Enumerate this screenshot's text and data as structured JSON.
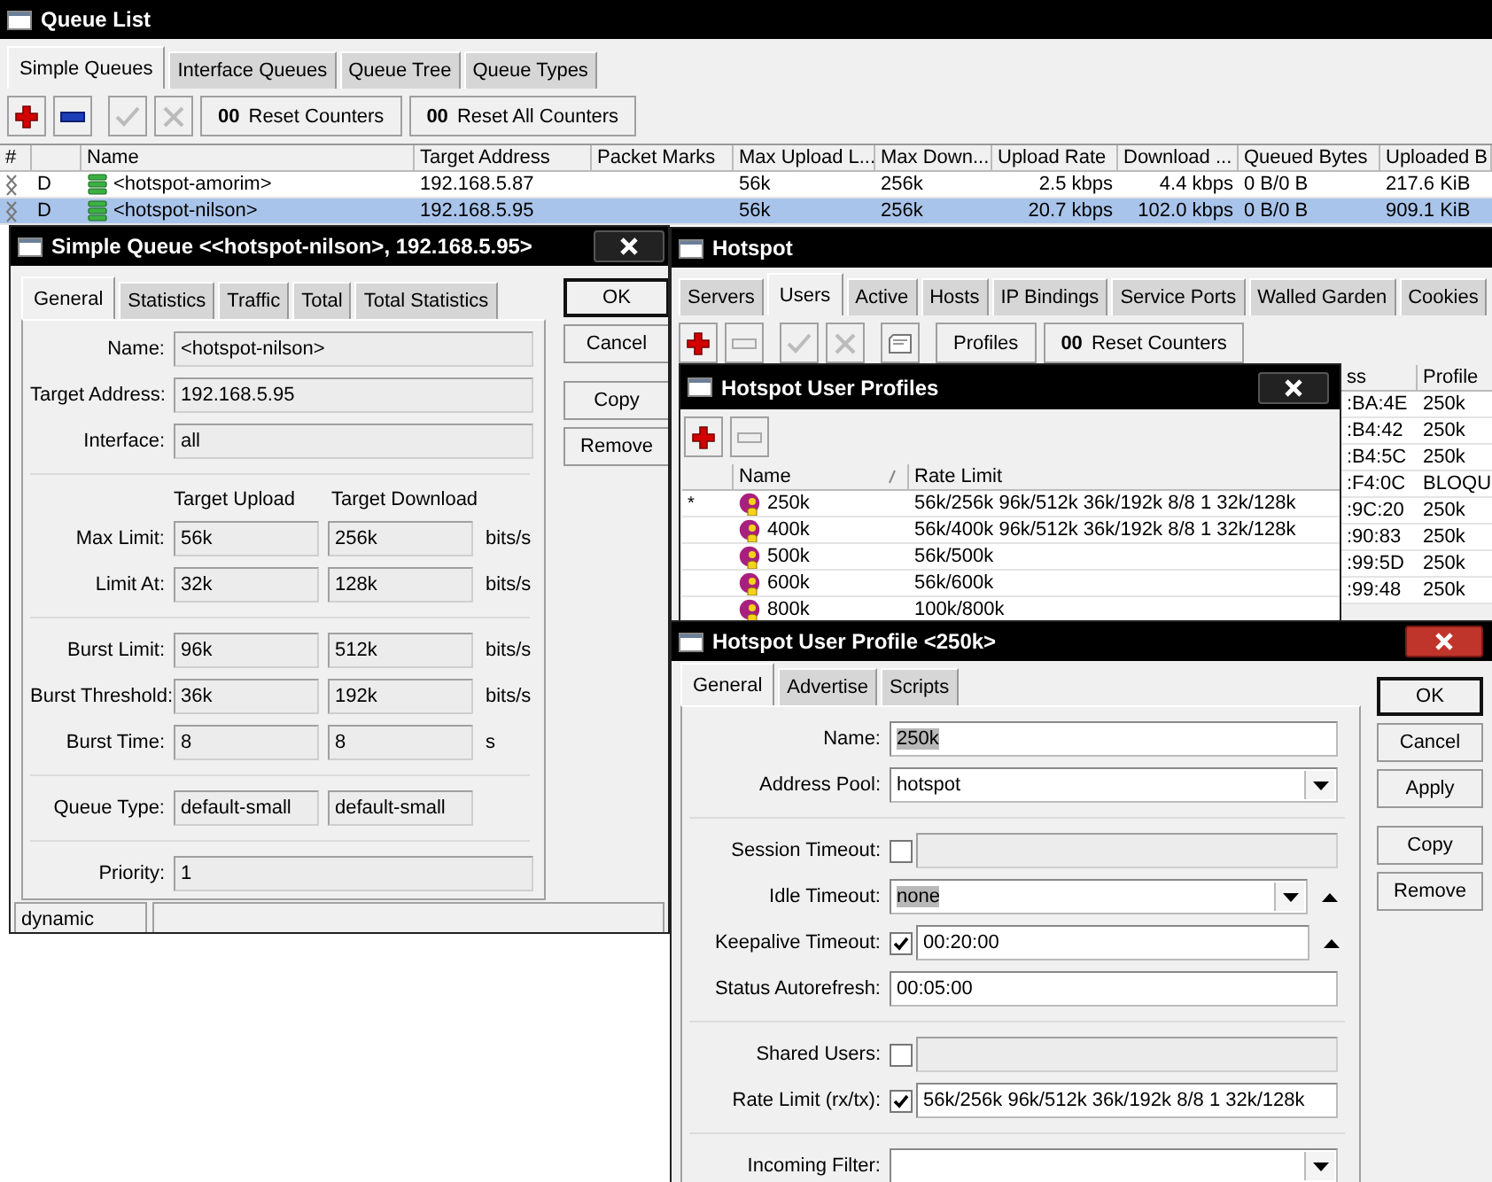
{
  "queue_list": {
    "title": "Queue List",
    "tabs": [
      {
        "label": "Simple Queues",
        "selected": true
      },
      {
        "label": "Interface Queues",
        "selected": false
      },
      {
        "label": "Queue Tree",
        "selected": false
      },
      {
        "label": "Queue Types",
        "selected": false
      }
    ],
    "toolbar": [
      {
        "kind": "add",
        "disabled": false
      },
      {
        "kind": "remove",
        "disabled": false
      },
      {
        "kind": "enable",
        "disabled": true
      },
      {
        "kind": "disable",
        "disabled": true
      },
      {
        "kind": "counter",
        "glyph": "00",
        "label": "Reset Counters"
      },
      {
        "kind": "counter",
        "glyph": "00",
        "label": "Reset All Counters"
      }
    ],
    "columns": [
      "#",
      "Name",
      "Target Address",
      "Packet Marks",
      "Max Upload L...",
      "Max Down...",
      "Upload Rate",
      "Download ...",
      "Queued Bytes",
      "Uploaded B"
    ],
    "rows": [
      {
        "flag": "D",
        "name": "<hotspot-amorim>",
        "target_address": "192.168.5.87",
        "max_upload": "56k",
        "max_download": "256k",
        "upload_rate": "2.5 kbps",
        "download_rate": "4.4 kbps",
        "queued_bytes": "0 B/0 B",
        "uploaded": "217.6 KiB",
        "selected": false
      },
      {
        "flag": "D",
        "name": "<hotspot-nilson>",
        "target_address": "192.168.5.95",
        "max_upload": "56k",
        "max_download": "256k",
        "upload_rate": "20.7 kbps",
        "download_rate": "102.0 kbps",
        "queued_bytes": "0 B/0 B",
        "uploaded": "909.1 KiB",
        "selected": true
      }
    ]
  },
  "simple_queue": {
    "title": "Simple Queue <<hotspot-nilson>, 192.168.5.95>",
    "active": false,
    "tabs": [
      {
        "label": "General",
        "selected": true
      },
      {
        "label": "Statistics",
        "selected": false
      },
      {
        "label": "Traffic",
        "selected": false
      },
      {
        "label": "Total",
        "selected": false
      },
      {
        "label": "Total Statistics",
        "selected": false
      }
    ],
    "sections": [
      [
        {
          "kind": "single",
          "label": "Name:",
          "value": "<hotspot-nilson>"
        },
        {
          "kind": "single",
          "label": "Target Address:",
          "value": "192.168.5.95"
        },
        {
          "kind": "single",
          "label": "Interface:",
          "value": "all"
        }
      ],
      [
        {
          "kind": "header",
          "upload": "Target Upload",
          "download": "Target Download"
        },
        {
          "kind": "pair",
          "label": "Max Limit:",
          "upload": "56k",
          "download": "256k",
          "unit": "bits/s"
        },
        {
          "kind": "pair",
          "label": "Limit At:",
          "upload": "32k",
          "download": "128k",
          "unit": "bits/s"
        }
      ],
      [
        {
          "kind": "pair",
          "label": "Burst Limit:",
          "upload": "96k",
          "download": "512k",
          "unit": "bits/s"
        },
        {
          "kind": "pair",
          "label": "Burst Threshold:",
          "upload": "36k",
          "download": "192k",
          "unit": "bits/s"
        },
        {
          "kind": "pair",
          "label": "Burst Time:",
          "upload": "8",
          "download": "8",
          "unit": "s"
        }
      ],
      [
        {
          "kind": "pair",
          "label": "Queue Type:",
          "upload": "default-small",
          "download": "default-small"
        }
      ],
      [
        {
          "kind": "single",
          "label": "Priority:",
          "value": "1"
        }
      ]
    ],
    "button_groups": [
      [
        {
          "label": "OK",
          "default": true
        },
        {
          "label": "Cancel",
          "default": false
        }
      ],
      [
        {
          "label": "Copy",
          "default": false
        },
        {
          "label": "Remove",
          "default": false
        }
      ]
    ],
    "status": "dynamic"
  },
  "hotspot": {
    "title": "Hotspot",
    "tabs": [
      {
        "label": "Servers",
        "selected": false
      },
      {
        "label": "Users",
        "selected": true
      },
      {
        "label": "Active",
        "selected": false
      },
      {
        "label": "Hosts",
        "selected": false
      },
      {
        "label": "IP Bindings",
        "selected": false
      },
      {
        "label": "Service Ports",
        "selected": false
      },
      {
        "label": "Walled Garden",
        "selected": false
      },
      {
        "label": "Cookies",
        "selected": false
      }
    ],
    "toolbar": [
      {
        "kind": "add",
        "disabled": false
      },
      {
        "kind": "remove",
        "disabled": true
      },
      {
        "kind": "enable",
        "disabled": true
      },
      {
        "kind": "disable",
        "disabled": true
      },
      {
        "kind": "comment",
        "disabled": false
      },
      {
        "kind": "text",
        "label": "Profiles"
      },
      {
        "kind": "counter",
        "glyph": "00",
        "label": "Reset Counters"
      }
    ],
    "users_table": {
      "columns": [
        "ss",
        "Profile"
      ],
      "rows": [
        {
          "address": ":BA:4E",
          "profile": "250k"
        },
        {
          "address": ":B4:42",
          "profile": "250k"
        },
        {
          "address": ":B4:5C",
          "profile": "250k"
        },
        {
          "address": ":F4:0C",
          "profile": "BLOQU"
        },
        {
          "address": ":9C:20",
          "profile": "250k"
        },
        {
          "address": ":90:83",
          "profile": "250k"
        },
        {
          "address": ":99:5D",
          "profile": "250k"
        },
        {
          "address": ":99:48",
          "profile": "250k"
        }
      ]
    }
  },
  "user_profiles": {
    "title": "Hotspot User Profiles",
    "active": false,
    "toolbar": [
      {
        "kind": "add",
        "disabled": false
      },
      {
        "kind": "remove",
        "disabled": true
      }
    ],
    "columns": [
      "Name",
      "Rate Limit"
    ],
    "rows": [
      {
        "marker": "*",
        "name": "250k",
        "rate_limit": "56k/256k 96k/512k 36k/192k 8/8 1 32k/128k"
      },
      {
        "name": "400k",
        "rate_limit": "56k/400k 96k/512k 36k/192k 8/8 1 32k/128k"
      },
      {
        "name": "500k",
        "rate_limit": "56k/500k"
      },
      {
        "name": "600k",
        "rate_limit": "56k/600k"
      },
      {
        "name": "800k",
        "rate_limit": "100k/800k"
      }
    ]
  },
  "profile_window": {
    "title": "Hotspot User Profile <250k>",
    "active": true,
    "tabs": [
      {
        "label": "General",
        "selected": true
      },
      {
        "label": "Advertise",
        "selected": false
      },
      {
        "label": "Scripts",
        "selected": false
      }
    ],
    "sections": [
      [
        {
          "kind": "text",
          "label": "Name:",
          "value": "250k",
          "highlighted": true,
          "arrow": false
        },
        {
          "kind": "dropdown",
          "label": "Address Pool:",
          "value": "hotspot",
          "highlighted": false,
          "arrow": false
        }
      ],
      [
        {
          "kind": "check_text",
          "label": "Session Timeout:",
          "checked": false,
          "arrow": false
        },
        {
          "kind": "dropdown",
          "label": "Idle Timeout:",
          "value": "none",
          "highlighted": true,
          "arrow": true
        },
        {
          "kind": "check_text",
          "label": "Keepalive Timeout:",
          "checked": true,
          "value": "00:20:00",
          "highlighted": false,
          "arrow": true
        },
        {
          "kind": "text",
          "label": "Status Autorefresh:",
          "value": "00:05:00",
          "highlighted": false,
          "arrow": false
        }
      ],
      [
        {
          "kind": "check_text",
          "label": "Shared Users:",
          "checked": false,
          "arrow": false
        },
        {
          "kind": "check_text",
          "label": "Rate Limit (rx/tx):",
          "checked": true,
          "value": "56k/256k 96k/512k 36k/192k 8/8 1 32k/128k",
          "highlighted": false,
          "arrow": false
        }
      ],
      [
        {
          "kind": "dropdown",
          "label": "Incoming Filter:",
          "arrow": false
        }
      ]
    ],
    "button_groups": [
      [
        {
          "label": "OK",
          "default": true
        },
        {
          "label": "Cancel",
          "default": false
        },
        {
          "label": "Apply",
          "default": false
        }
      ],
      [
        {
          "label": "Copy",
          "default": false
        },
        {
          "label": "Remove",
          "default": false
        }
      ]
    ]
  }
}
